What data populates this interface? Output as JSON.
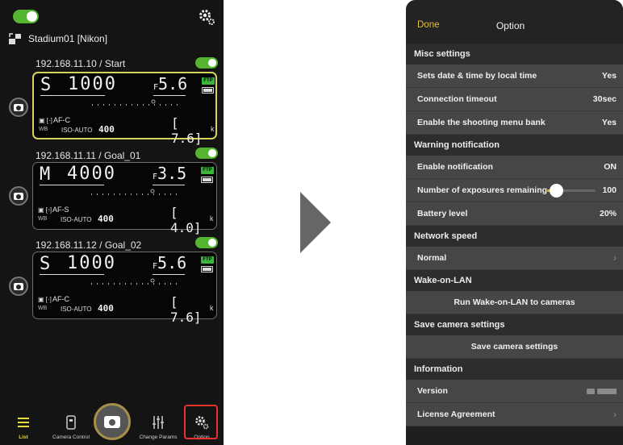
{
  "left_phone": {
    "group_name": "Stadium01 [Nikon]",
    "cameras": [
      {
        "title": "192.168.11.10 / Start",
        "enabled": true,
        "mode": "S",
        "shutter": "1000",
        "aperture_prefix": "F",
        "aperture": "5.6",
        "ftp": "FTP",
        "af_mode": "AF-C",
        "wb": "WB",
        "iso": "ISO-AUTO",
        "iso_value": "400",
        "remaining": "[  7.6]",
        "unit": "k",
        "selected": true
      },
      {
        "title": "192.168.11.11 / Goal_01",
        "enabled": true,
        "mode": "M",
        "shutter": "4000",
        "aperture_prefix": "F",
        "aperture": "3.5",
        "ftp": "FTP",
        "af_mode": "AF-S",
        "wb": "WB",
        "iso": "ISO-AUTO",
        "iso_value": "400",
        "remaining": "[  4.0]",
        "unit": "k",
        "selected": false
      },
      {
        "title": "192.168.11.12 / Goal_02",
        "enabled": true,
        "mode": "S",
        "shutter": "1000",
        "aperture_prefix": "F",
        "aperture": "5.6",
        "ftp": "FTP",
        "af_mode": "AF-C",
        "wb": "WB",
        "iso": "ISO-AUTO",
        "iso_value": "400",
        "remaining": "[  7.6]",
        "unit": "k",
        "selected": false
      }
    ],
    "tabs": {
      "list": "List",
      "camera_control": "Camera Control",
      "change_params": "Change Params",
      "option": "Option"
    },
    "accent_color": "#55b531",
    "highlight_color": "#e8322c"
  },
  "right_phone": {
    "nav": {
      "done": "Done",
      "title": "Option"
    },
    "sections": {
      "misc": {
        "header": "Misc settings",
        "date_label": "Sets date & time by local time",
        "date_value": "Yes",
        "timeout_label": "Connection timeout",
        "timeout_value": "30sec",
        "bank_label": "Enable the shooting menu bank",
        "bank_value": "Yes"
      },
      "warning": {
        "header": "Warning notification",
        "enable_label": "Enable notification",
        "enable_value": "ON",
        "exposures_label": "Number of exposures remaining",
        "exposures_value": "100",
        "exposures_slider_fraction": 0.18,
        "battery_label": "Battery level",
        "battery_value": "20%"
      },
      "network": {
        "header": "Network speed",
        "speed_value": "Normal"
      },
      "wol": {
        "header": "Wake-on-LAN",
        "button": "Run Wake-on-LAN to cameras"
      },
      "save": {
        "header": "Save camera settings",
        "button": "Save camera settings"
      },
      "info": {
        "header": "Information",
        "version_label": "Version",
        "license_label": "License Agreement"
      }
    },
    "accent_color": "#e0c13c"
  }
}
